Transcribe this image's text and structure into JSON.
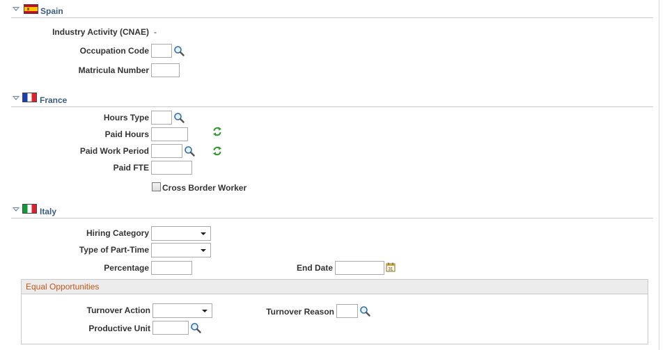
{
  "spain": {
    "title": "Spain",
    "industry_activity_label": "Industry Activity (CNAE)",
    "industry_activity_value": "-",
    "occupation_code_label": "Occupation Code",
    "occupation_code_value": "",
    "matricula_number_label": "Matricula Number",
    "matricula_number_value": ""
  },
  "france": {
    "title": "France",
    "hours_type_label": "Hours Type",
    "hours_type_value": "",
    "paid_hours_label": "Paid Hours",
    "paid_hours_value": "",
    "paid_work_period_label": "Paid Work Period",
    "paid_work_period_value": "",
    "paid_fte_label": "Paid FTE",
    "paid_fte_value": "",
    "cross_border_label": "Cross Border Worker",
    "cross_border_checked": false
  },
  "italy": {
    "title": "Italy",
    "hiring_category_label": "Hiring Category",
    "hiring_category_value": "",
    "part_time_label": "Type of Part-Time",
    "part_time_value": "",
    "percentage_label": "Percentage",
    "percentage_value": "",
    "end_date_label": "End Date",
    "end_date_value": "",
    "equal_opportunities": {
      "title": "Equal Opportunities",
      "turnover_action_label": "Turnover Action",
      "turnover_action_value": "",
      "turnover_reason_label": "Turnover Reason",
      "turnover_reason_value": "",
      "productive_unit_label": "Productive Unit",
      "productive_unit_value": ""
    }
  },
  "icons": {
    "collapse": "triangle-down-icon",
    "lookup": "magnifier-icon",
    "refresh": "refresh-icon",
    "calendar": "calendar-icon"
  },
  "colors": {
    "section_title": "#3c5a82",
    "group_title": "#c1571b",
    "refresh": "#2e9a2e"
  }
}
